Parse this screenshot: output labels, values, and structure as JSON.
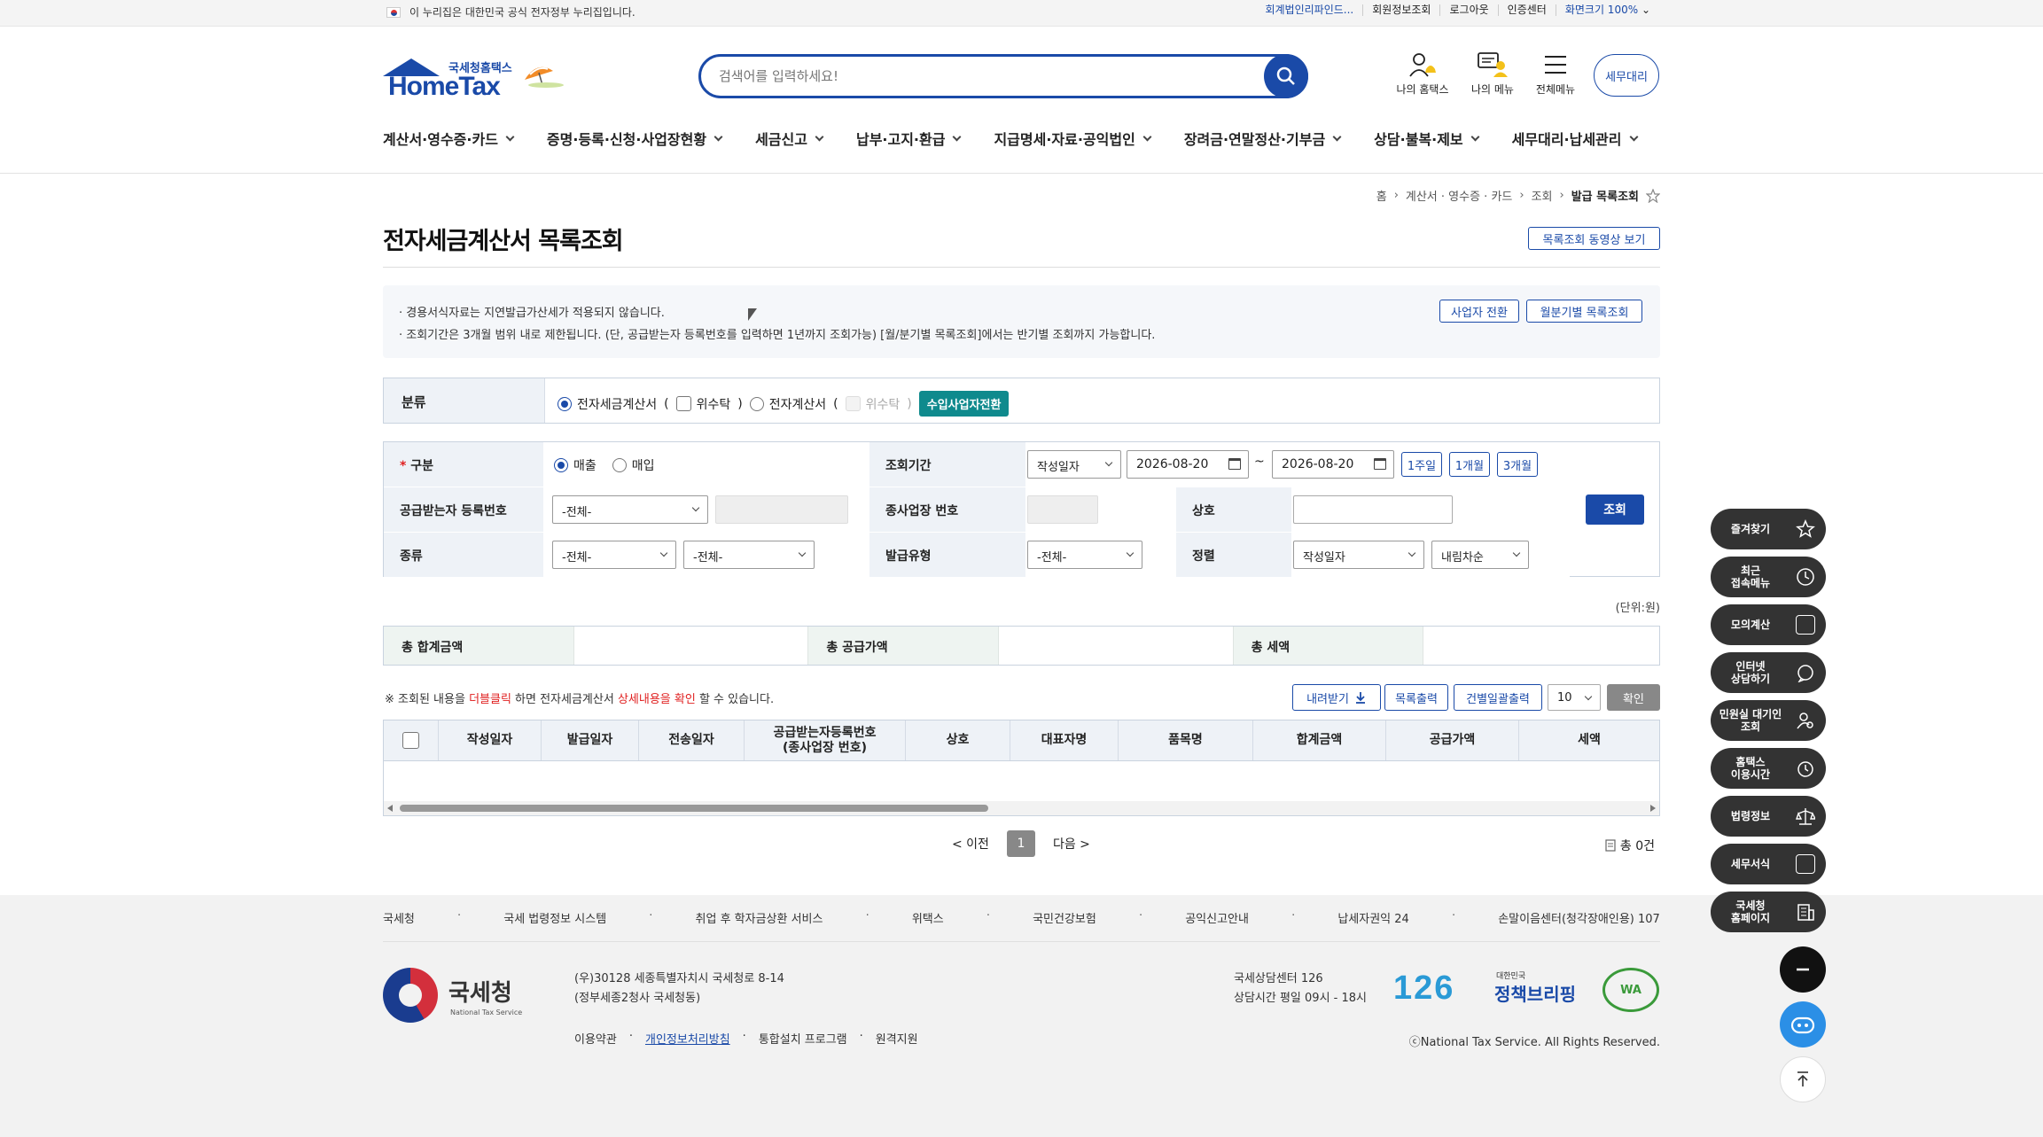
{
  "topbar": {
    "notice": "이 누리집은 대한민국 공식 전자정부 누리집입니다.",
    "links": [
      "회계법인리파인드...",
      "회원정보조회",
      "로그아웃",
      "인증센터",
      "화면크기 100%"
    ]
  },
  "header": {
    "logo_sub": "국세청홈택스",
    "logo_main": "HomeTax",
    "search_placeholder": "검색어를 입력하세요!",
    "icons": [
      {
        "label": "나의 홈택스",
        "icon": "person-bell-icon"
      },
      {
        "label": "나의 메뉴",
        "icon": "person-chat-icon"
      },
      {
        "label": "전체메뉴",
        "icon": "hamburger-icon"
      }
    ],
    "agent_label": "세무대리"
  },
  "gnb": [
    "계산서·영수증·카드",
    "증명·등록·신청·사업장현황",
    "세금신고",
    "납부·고지·환급",
    "지급명세·자료·공익법인",
    "장려금·연말정산·기부금",
    "상담·불복·제보",
    "세무대리·납세관리"
  ],
  "breadcrumb": [
    "홈",
    "계산서 · 영수증 · 카드",
    "조회",
    "발급 목록조회"
  ],
  "page": {
    "title": "전자세금계산서 목록조회",
    "video_btn": "목록조회 동영상 보기",
    "info1": "· 경용서식자료는 지연발급가산세가 적용되지 않습니다.",
    "info2": "· 조회기간은 3개월 범위 내로 제한됩니다. (단, 공급받는자 등록번호를 입력하면 1년까지 조회가능) [월/분기별 목록조회]에서는 반기별 조회까지 가능합니다.",
    "switch_btn": "사업자 전환",
    "monthly_btn": "월분기별 목록조회"
  },
  "classification": {
    "label": "분류",
    "opt1": "전자세금계산서",
    "paren_open": "(",
    "trust1": "위수탁",
    "paren_close": ")",
    "opt2": "전자계산서",
    "trust2": "위수탁",
    "import_btn": "수입사업자전환"
  },
  "form": {
    "gubun_label": "구분",
    "sale": "매출",
    "purchase": "매입",
    "period_label": "조회기간",
    "period_type": "작성일자",
    "date_from": "2026-08-20",
    "tilde": "~",
    "date_to": "2026-08-20",
    "p1": "1주일",
    "p2": "1개월",
    "p3": "3개월",
    "reg_label": "공급받는자 등록번호",
    "reg_select": "-전체-",
    "branch_label": "종사업장 번호",
    "company_label": "상호",
    "kind_label": "종류",
    "kind1": "-전체-",
    "kind2": "-전체-",
    "issue_type_label": "발급유형",
    "issue_type": "-전체-",
    "sort_label": "정렬",
    "sort_field": "작성일자",
    "sort_order": "내림차순",
    "search_btn": "조회"
  },
  "totals": {
    "unit": "(단위:원)",
    "sum_label": "총 합계금액",
    "supply_label": "총 공급가액",
    "tax_label": "총 세액"
  },
  "list": {
    "note_a": "※ 조회된 내용을 ",
    "note_red1": "더블클릭",
    "note_b": " 하면 전자세금계산서 ",
    "note_red2": "상세내용을 확인",
    "note_c": " 할 수 있습니다.",
    "download_btn": "내려받기",
    "print_btn": "목록출력",
    "bulk_print_btn": "건별일괄출력",
    "page_size": "10",
    "ok_btn": "확인",
    "columns": [
      "작성일자",
      "발급일자",
      "전송일자",
      "공급받는자등록번호\n(종사업장 번호)",
      "상호",
      "대표자명",
      "품목명",
      "합계금액",
      "공급가액",
      "세액"
    ]
  },
  "pager": {
    "prev": "< 이전",
    "current": "1",
    "next": "다음 >",
    "total": "총 0건"
  },
  "footer": {
    "links": [
      "국세청",
      "국세 법령정보 시스템",
      "취업 후 학자금상환 서비스",
      "위택스",
      "국민건강보험",
      "공익신고안내",
      "납세자권익 24",
      "손말이음센터(청각장애인용) 107"
    ],
    "org": "국세청",
    "org_en": "National Tax Service",
    "addr1": "(우)30128 세종특별자치시 국세청로 8-14",
    "addr2": "(정부세종2청사 국세청동)",
    "links2": [
      "이용약관",
      "개인정보처리방침",
      "통합설치 프로그램",
      "원격지원"
    ],
    "center": "국세상담센터 126",
    "hours": "상담시간 평일 09시 - 18시",
    "badge126": "126",
    "policy_small": "대한민국",
    "policy_big": "정책브리핑",
    "wa": "WA",
    "copyright": "ⓒNational Tax Service. All Rights Reserved."
  },
  "quickmenu": [
    {
      "label": "즐겨찾기",
      "icon": "star-icon"
    },
    {
      "label": "최근\n접속메뉴",
      "icon": "clock-icon"
    },
    {
      "label": "모의계산",
      "icon": "calculator-icon"
    },
    {
      "label": "인터넷\n상담하기",
      "icon": "chat-icon"
    },
    {
      "label": "민원실 대기인\n조회",
      "icon": "person-search-icon"
    },
    {
      "label": "홈택스\n이용시간",
      "icon": "alarm-icon"
    },
    {
      "label": "법령정보",
      "icon": "scale-icon"
    },
    {
      "label": "세무서식",
      "icon": "form-edit-icon"
    },
    {
      "label": "국세청\n홈페이지",
      "icon": "building-icon"
    }
  ]
}
